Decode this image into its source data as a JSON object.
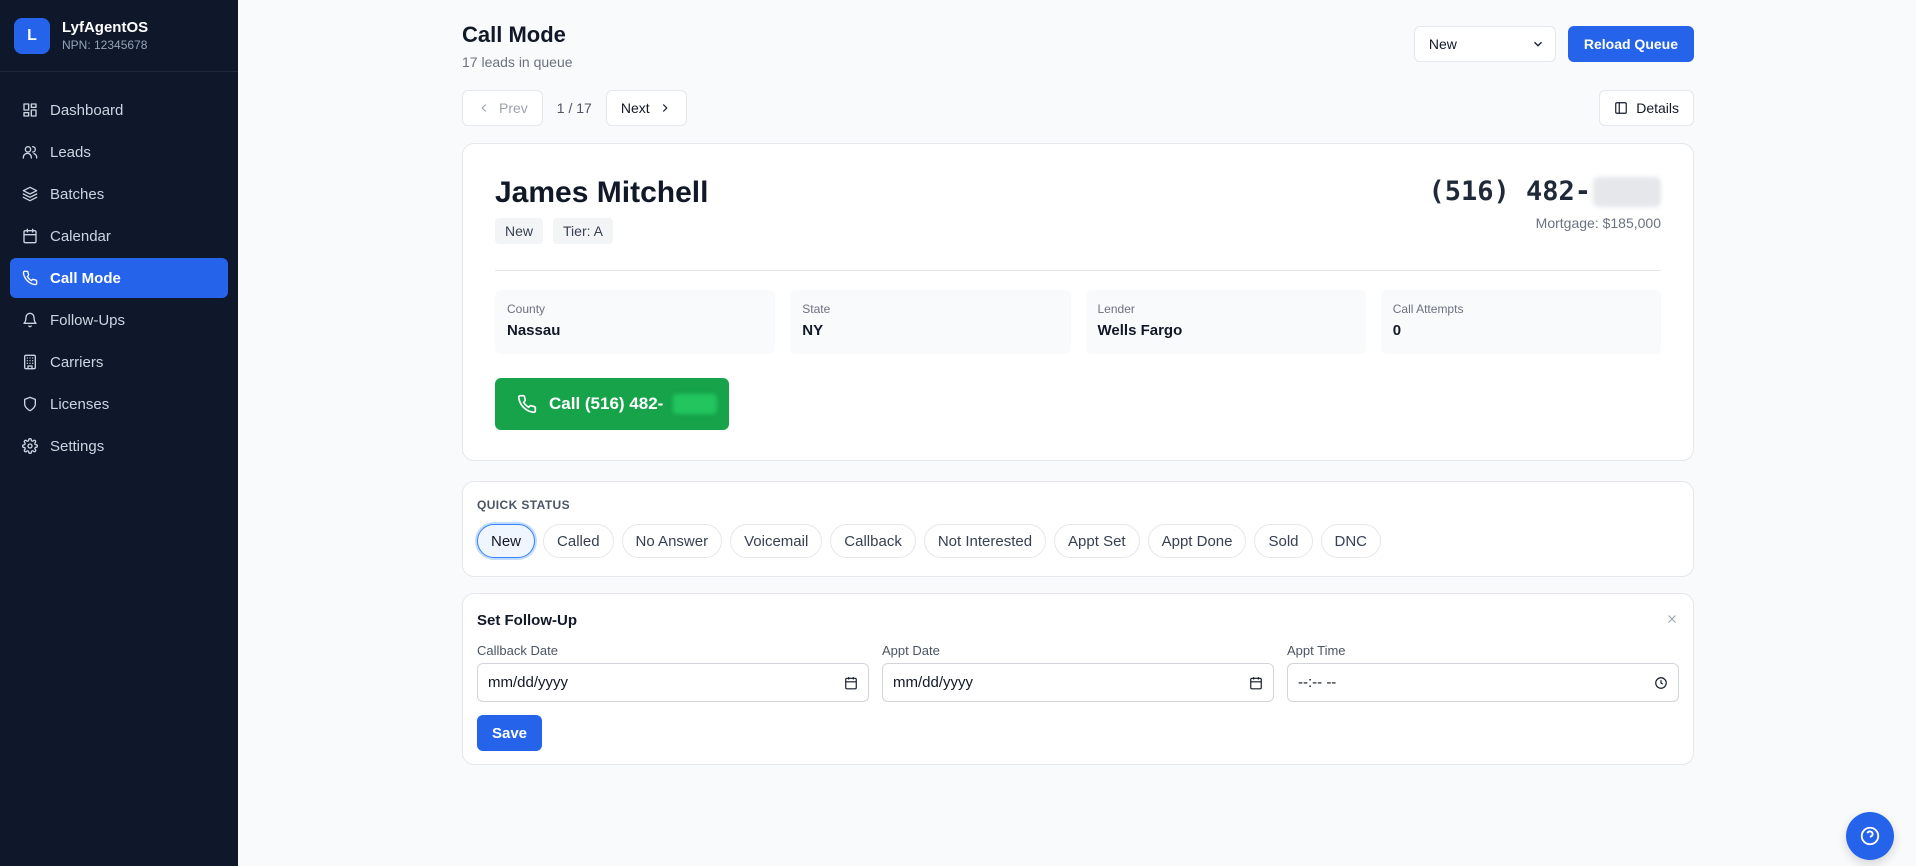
{
  "brand": {
    "logo_letter": "L",
    "name": "LyfAgentOS",
    "npn": "NPN: 12345678"
  },
  "sidebar": {
    "items": [
      {
        "label": "Dashboard",
        "icon": "dashboard-icon"
      },
      {
        "label": "Leads",
        "icon": "users-icon"
      },
      {
        "label": "Batches",
        "icon": "layers-icon"
      },
      {
        "label": "Calendar",
        "icon": "calendar-icon"
      },
      {
        "label": "Call Mode",
        "icon": "phone-icon",
        "active": true
      },
      {
        "label": "Follow-Ups",
        "icon": "bell-icon"
      },
      {
        "label": "Carriers",
        "icon": "building-icon"
      },
      {
        "label": "Licenses",
        "icon": "shield-icon"
      },
      {
        "label": "Settings",
        "icon": "gear-icon"
      }
    ]
  },
  "header": {
    "title": "Call Mode",
    "subtitle": "17 leads in queue",
    "filter_value": "New",
    "reload_label": "Reload Queue"
  },
  "pager": {
    "prev_label": "Prev",
    "count": "1 / 17",
    "next_label": "Next",
    "details_label": "Details"
  },
  "lead": {
    "name": "James Mitchell",
    "status_badge": "New",
    "tier_badge": "Tier: A",
    "phone_visible": "(516) 482-",
    "mortgage": "Mortgage: $185,000",
    "info": [
      {
        "label": "County",
        "value": "Nassau"
      },
      {
        "label": "State",
        "value": "NY"
      },
      {
        "label": "Lender",
        "value": "Wells Fargo"
      },
      {
        "label": "Call Attempts",
        "value": "0"
      }
    ],
    "call_label": "Call (516) 482-"
  },
  "quick_status": {
    "label": "QUICK STATUS",
    "options": [
      "New",
      "Called",
      "No Answer",
      "Voicemail",
      "Callback",
      "Not Interested",
      "Appt Set",
      "Appt Done",
      "Sold",
      "DNC"
    ],
    "selected": "New"
  },
  "followup": {
    "title": "Set Follow-Up",
    "fields": [
      {
        "label": "Callback Date",
        "value": "mm/dd/yyyy",
        "icon": "calendar-icon"
      },
      {
        "label": "Appt Date",
        "value": "mm/dd/yyyy",
        "icon": "calendar-icon"
      },
      {
        "label": "Appt Time",
        "value": "--:-- --",
        "icon": "clock-icon"
      }
    ],
    "save_label": "Save"
  },
  "colors": {
    "sidebar_bg": "#0f172a",
    "accent": "#2563eb",
    "call_green": "#16a34a"
  }
}
